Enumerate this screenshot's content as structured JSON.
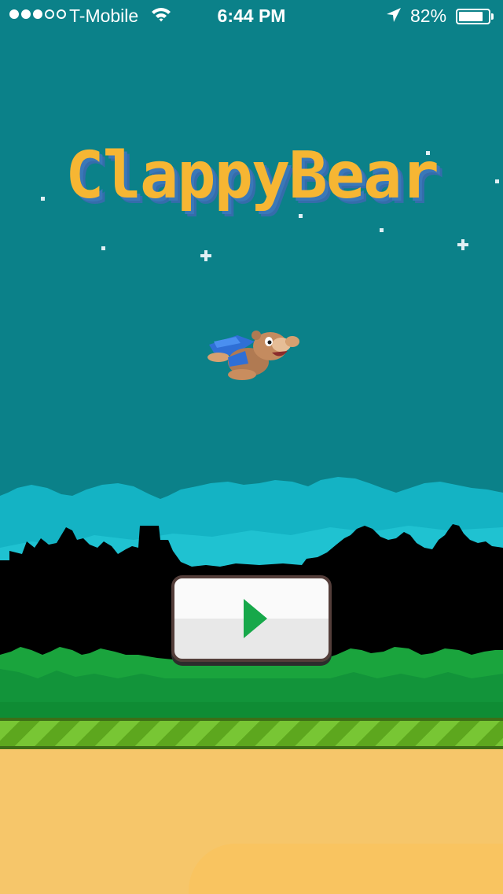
{
  "status_bar": {
    "signal_bars": 3,
    "signal_total": 5,
    "carrier": "T-Mobile",
    "time": "6:44 PM",
    "battery_percent": "82%",
    "battery_level": 0.82,
    "wifi_icon": "wifi-icon",
    "location_icon": "location-arrow-icon"
  },
  "game": {
    "title": "ClappyBear",
    "title_color": "#f6b633",
    "title_shadow_color": "#3a78b8",
    "sky_color": "#0b8189",
    "character": "flying-bear-with-cape",
    "play_button_icon": "play-icon"
  },
  "colors": {
    "cloud": "#14b3c4",
    "trees": "#000000",
    "bushes": "#1aa43d",
    "ground_stripe": "#78c634",
    "sand": "#f6c66a",
    "play_arrow": "#17a84a"
  }
}
